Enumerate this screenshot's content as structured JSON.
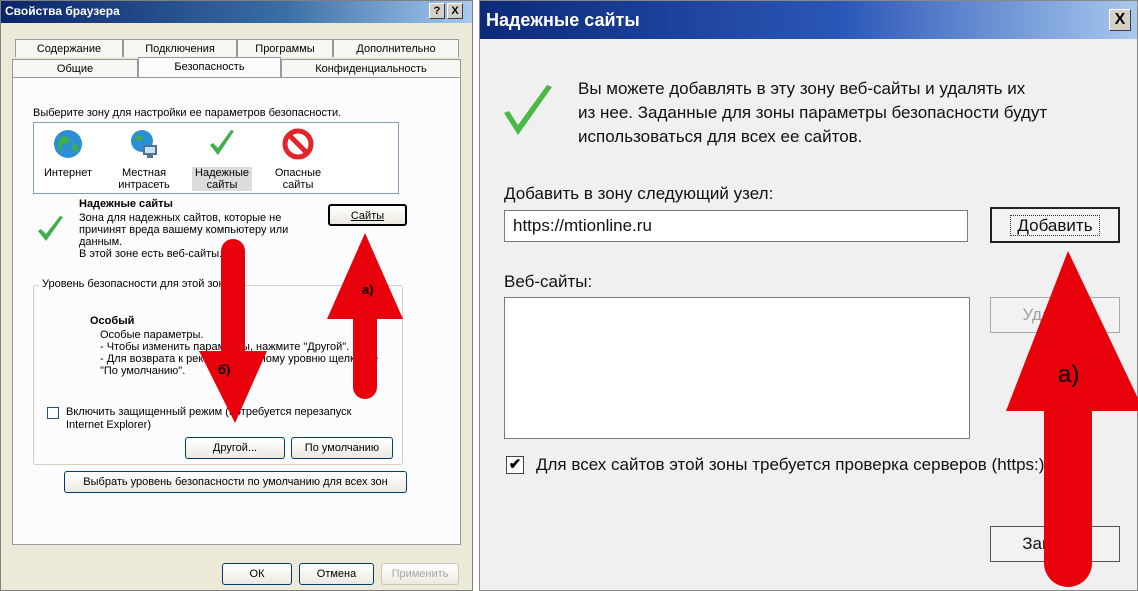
{
  "left": {
    "title": "Свойства браузера",
    "help_btn": "?",
    "close_btn": "X",
    "tabs_row1": [
      "Содержание",
      "Подключения",
      "Программы",
      "Дополнительно"
    ],
    "tabs_row2": [
      "Общие",
      "Безопасность",
      "Конфиденциальность"
    ],
    "zone_prompt": "Выберите зону для настройки ее параметров безопасности.",
    "zones": [
      {
        "label1": "Интернет",
        "label2": "",
        "icon": "globe-icon"
      },
      {
        "label1": "Местная",
        "label2": "интрасеть",
        "icon": "intranet-icon"
      },
      {
        "label1": "Надежные",
        "label2": "сайты",
        "icon": "checkmark-icon"
      },
      {
        "label1": "Опасные",
        "label2": "сайты",
        "icon": "forbidden-icon"
      }
    ],
    "zone_title": "Надежные сайты",
    "zone_desc": [
      "Зона для надежных сайтов, которые не",
      "причинят вреда вашему компьютеру или",
      "данным.",
      "В этой зоне есть веб-сайты."
    ],
    "sites_btn": "Сайты",
    "level_group": "Уровень безопасности для этой зоны",
    "level_name": "Особый",
    "level_desc": [
      "Особые параметры.",
      "- Чтобы изменить параметры, нажмите \"Другой\".",
      "- Для возврата к рекомендованному уровню щелкните",
      "\"По умолчанию\"."
    ],
    "protected_mode": "Включить защищенный режим (потребуется перезапуск",
    "protected_mode2": "Internet Explorer)",
    "other_btn": "Другой...",
    "default_btn": "По умолчанию",
    "reset_all_btn": "Выбрать уровень безопасности по умолчанию для всех зон",
    "ok_btn": "ОК",
    "cancel_btn": "Отмена",
    "apply_btn": "Применить",
    "annot_a": "а)",
    "annot_b": "б)"
  },
  "right": {
    "title": "Надежные сайты",
    "close_btn": "X",
    "info": [
      "Вы можете добавлять в эту зону  веб-сайты и удалять их",
      "из нее. Заданные для зоны параметры безопасности будут",
      "использоваться для всех ее сайтов."
    ],
    "add_label": "Добавить в зону следующий узел:",
    "add_value": "https://mtionline.ru",
    "add_btn": "Добавить",
    "sites_label": "Веб-сайты:",
    "remove_btn": "Удалить",
    "https_check": "Для всех сайтов этой зоны требуется проверка серверов (https:)",
    "close_bottom_btn": "Закрыть",
    "annot_a": "а)"
  },
  "colors": {
    "arrow": "#e8000a",
    "selection": "#dcdcdc",
    "title_left": "#0a246a",
    "title_right": "#0b2a7a"
  }
}
